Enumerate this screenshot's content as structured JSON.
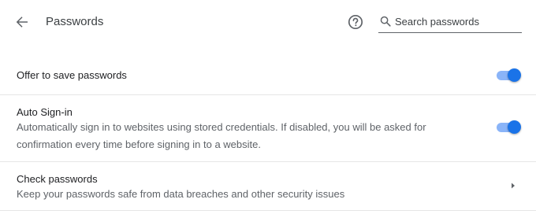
{
  "header": {
    "back_icon": "arrow-back-icon",
    "title": "Passwords",
    "help_icon": "help-circle-icon",
    "search": {
      "icon": "search-icon",
      "placeholder": "Search passwords",
      "value": ""
    }
  },
  "settings": {
    "offer_to_save": {
      "label": "Offer to save passwords",
      "enabled": true
    },
    "auto_sign_in": {
      "label": "Auto Sign-in",
      "description": "Automatically sign in to websites using stored credentials. If disabled, you will be asked for confirmation every time before signing in to a website.",
      "enabled": true
    },
    "check_passwords": {
      "label": "Check passwords",
      "description": "Keep your passwords safe from data breaches and other security issues",
      "icon": "chevron-right-icon"
    }
  },
  "colors": {
    "accent": "#1a73e8",
    "toggle_track": "#8ab4f8",
    "text_primary": "#202124",
    "text_secondary": "#5f6368",
    "divider": "#e6e6e6"
  }
}
